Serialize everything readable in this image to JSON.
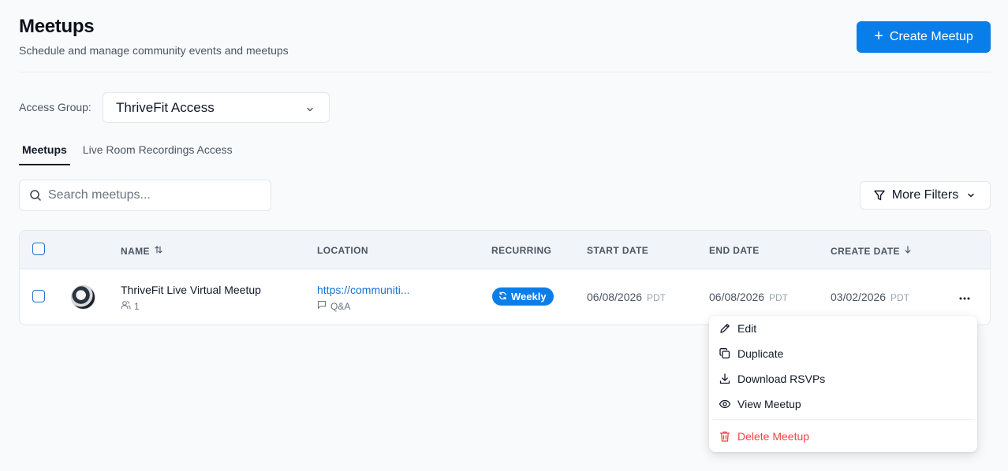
{
  "header": {
    "title": "Meetups",
    "subtitle": "Schedule and manage community events and meetups",
    "create_button": "Create Meetup"
  },
  "access_group": {
    "label": "Access Group:",
    "value": "ThriveFit Access"
  },
  "tabs": [
    {
      "label": "Meetups",
      "active": true
    },
    {
      "label": "Live Room Recordings Access",
      "active": false
    }
  ],
  "search": {
    "placeholder": "Search meetups..."
  },
  "filters": {
    "label": "More Filters"
  },
  "table": {
    "columns": {
      "name": "NAME",
      "location": "LOCATION",
      "recurring": "RECURRING",
      "start_date": "START DATE",
      "end_date": "END DATE",
      "create_date": "CREATE DATE"
    },
    "rows": [
      {
        "name": "ThriveFit Live Virtual Meetup",
        "attendees": "1",
        "location_url": "https://communiti...",
        "location_type": "Q&A",
        "recurring": "Weekly",
        "start_date": "06/08/2026",
        "start_tz": "PDT",
        "end_date": "06/08/2026",
        "end_tz": "PDT",
        "create_date": "03/02/2026",
        "create_tz": "PDT"
      }
    ]
  },
  "menu": {
    "items": [
      "Edit",
      "Duplicate",
      "Download RSVPs",
      "View Meetup"
    ],
    "danger": "Delete Meetup"
  },
  "colors": {
    "primary": "#0a7ee8",
    "danger": "#ef4444",
    "link": "#1673d6"
  }
}
